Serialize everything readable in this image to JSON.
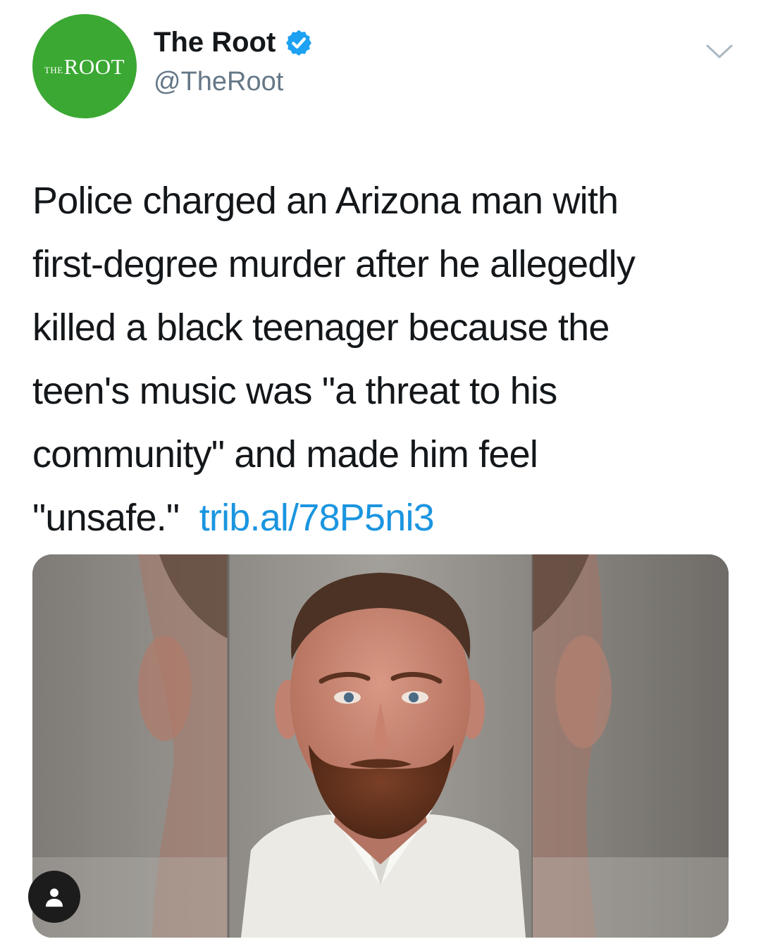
{
  "author": {
    "avatar_logo_small": "THE",
    "avatar_logo_big": "ROOT",
    "display_name": "The Root",
    "handle": "@TheRoot",
    "verified": true,
    "verified_icon": "verified-badge-icon",
    "menu_icon": "chevron-down-icon"
  },
  "tweet": {
    "lines": [
      "Police charged an Arizona man with",
      "first-degree murder after he allegedly",
      "killed a black teenager because the",
      "teen's music was \"a threat to his",
      "community\" and made him feel"
    ],
    "last_line_text": "\"unsafe.\"",
    "link": "trib.al/78P5ni3"
  },
  "media": {
    "type": "photo",
    "icon": "user-tag-icon"
  },
  "colors": {
    "accent": "#1b95e0",
    "avatar_green": "#3aa832",
    "text": "#14171a",
    "secondary_text": "#657786"
  }
}
